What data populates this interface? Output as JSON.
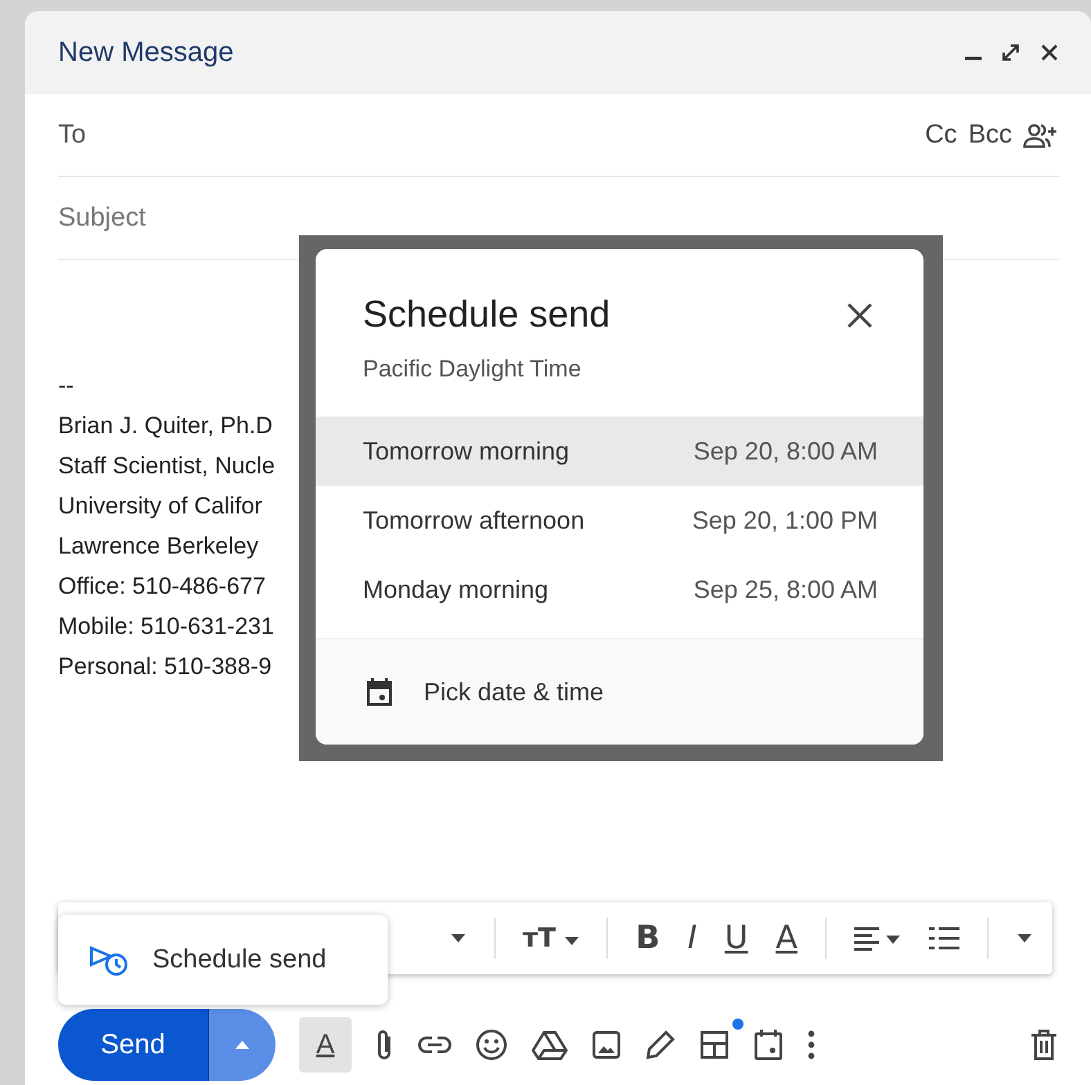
{
  "window": {
    "title": "New Message"
  },
  "recipients": {
    "to_label": "To",
    "cc": "Cc",
    "bcc": "Bcc"
  },
  "subject": {
    "placeholder": "Subject"
  },
  "signature": [
    "--",
    "Brian J. Quiter, Ph.D",
    "Staff Scientist, Nucle",
    "University of Califor",
    "Lawrence Berkeley",
    "Office: 510-486-677",
    "Mobile: 510-631-231",
    "Personal: 510-388-9"
  ],
  "schedule_dialog": {
    "title": "Schedule send",
    "timezone": "Pacific Daylight Time",
    "options": [
      {
        "label": "Tomorrow morning",
        "time": "Sep 20, 8:00 AM",
        "selected": true
      },
      {
        "label": "Tomorrow afternoon",
        "time": "Sep 20, 1:00 PM",
        "selected": false
      },
      {
        "label": "Monday morning",
        "time": "Sep 25, 8:00 AM",
        "selected": false
      }
    ],
    "pick_label": "Pick date & time"
  },
  "format_toolbar": [
    {
      "kind": "caret"
    },
    {
      "kind": "sep"
    },
    {
      "kind": "size",
      "glyph": "тT"
    },
    {
      "kind": "sep"
    },
    {
      "kind": "bold",
      "glyph": "B"
    },
    {
      "kind": "italic",
      "glyph": "I"
    },
    {
      "kind": "underline",
      "glyph": "U"
    },
    {
      "kind": "color",
      "glyph": "A"
    },
    {
      "kind": "sep"
    },
    {
      "kind": "align"
    },
    {
      "kind": "list"
    },
    {
      "kind": "sep"
    },
    {
      "kind": "caret"
    }
  ],
  "schedule_menu": {
    "label": "Schedule send"
  },
  "send_button": {
    "label": "Send"
  },
  "tools": [
    {
      "kind": "format",
      "glyph": "A",
      "selected": true
    },
    {
      "kind": "attach"
    },
    {
      "kind": "link"
    },
    {
      "kind": "emoji"
    },
    {
      "kind": "drive"
    },
    {
      "kind": "image"
    },
    {
      "kind": "pen"
    },
    {
      "kind": "layout",
      "dot": true
    },
    {
      "kind": "calendar"
    },
    {
      "kind": "more"
    }
  ]
}
